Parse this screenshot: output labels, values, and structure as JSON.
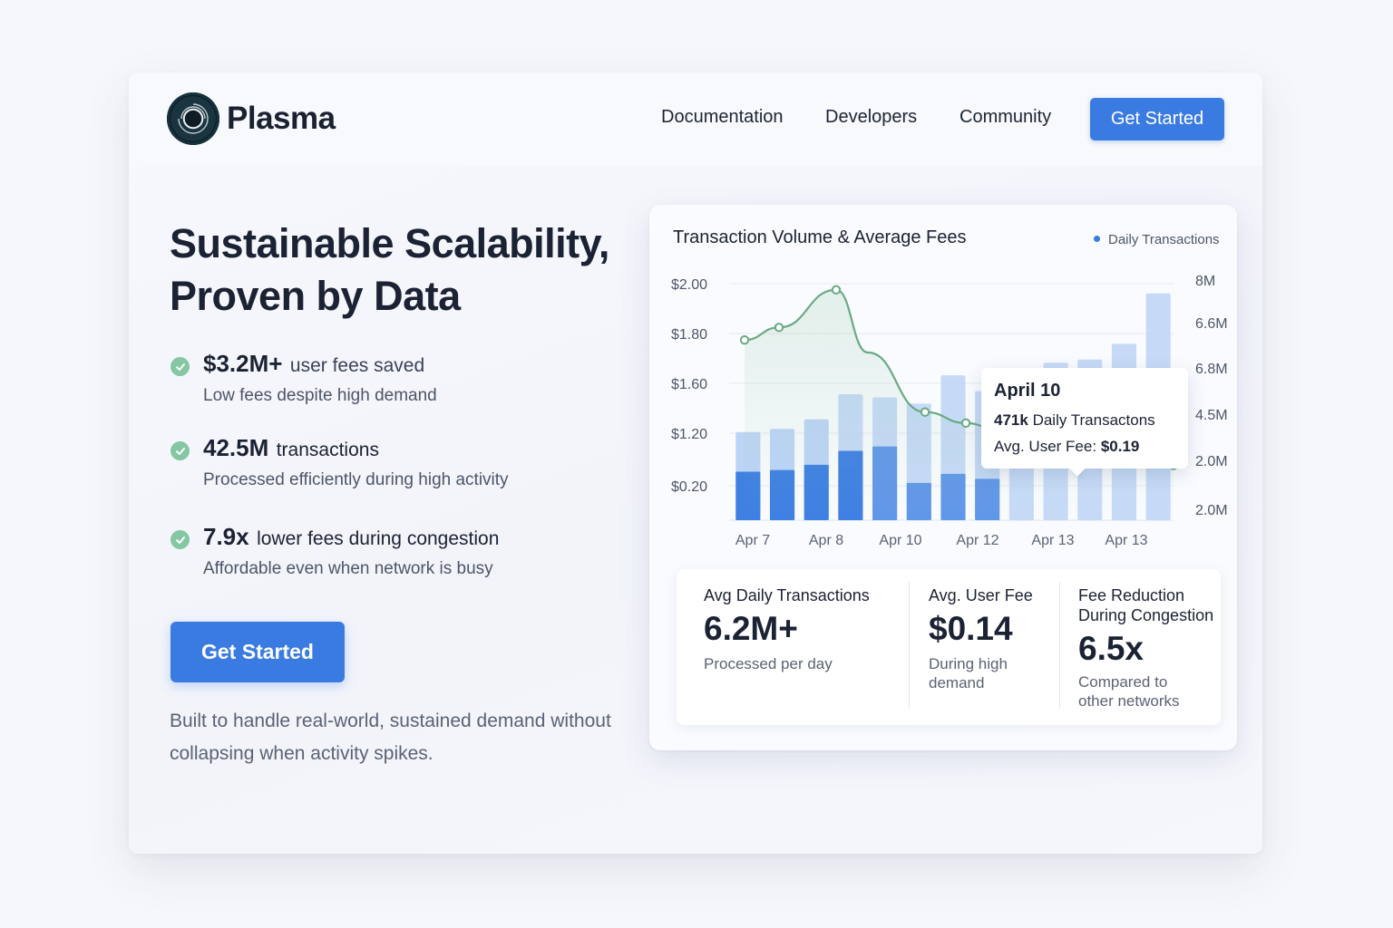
{
  "brand": {
    "name": "Plasma"
  },
  "nav": {
    "links": [
      "Documentation",
      "Developers",
      "Community"
    ],
    "cta": "Get Started"
  },
  "hero": {
    "title": "Sustainable Scalability, Proven by Data",
    "features": [
      {
        "highlight": "$3.2M+",
        "text": "user fees saved",
        "sub": "Low fees despite high demand"
      },
      {
        "highlight": "42.5M",
        "text": "transactions",
        "sub": "Processed efficiently during high activity"
      },
      {
        "highlight": "7.9x",
        "text": "lower fees during congestion",
        "sub": "Affordable even when network is busy"
      }
    ],
    "cta": "Get Started",
    "tagline": "Built to handle real-world, sustained demand without collapsing when activity spikes."
  },
  "chart_data": {
    "type": "bar",
    "title": "Transaction Volume & Average Fees",
    "legend": [
      "Daily Transactions"
    ],
    "legend_position": "top-right",
    "x_tick_labels": [
      "Apr 7",
      "Apr 8",
      "Apr 10",
      "Apr 12",
      "Apr 13",
      "Apr 13"
    ],
    "y_left_ticks": [
      "$2.00",
      "$1.80",
      "$1.60",
      "$1.20",
      "$0.20"
    ],
    "y_right_ticks": [
      "8M",
      "6.6M",
      "6.8M",
      "4.5M",
      "2.0M",
      "2.0M"
    ],
    "series": [
      {
        "name": "Daily Transactions",
        "kind": "bar",
        "values": [
          2.8,
          2.9,
          3.2,
          4.0,
          3.9,
          3.7,
          4.6,
          4.1,
          4.1,
          5.0,
          5.1,
          5.6,
          7.2
        ]
      },
      {
        "kind": "line",
        "values": [
          1.6,
          1.68,
          1.92,
          1.52,
          1.14,
          1.07,
          0.9,
          0.83,
          0.81,
          0.8
        ]
      }
    ],
    "tooltip": {
      "date": "April 10",
      "transactions": "471k",
      "transactions_label": "Daily Transactons",
      "fee_label": "Avg. User Fee:",
      "fee": "$0.19"
    }
  },
  "stats": [
    {
      "label": "Avg Daily Transactions",
      "value": "6.2M+",
      "note": "Processed per day"
    },
    {
      "label": "Avg. User Fee",
      "value": "$0.14",
      "note": "During high\ndemand"
    },
    {
      "label": "Fee Reduction\nDuring Congestion",
      "value": "6.5x",
      "note": "Compared to\nother networks"
    }
  ],
  "colors": {
    "accent": "#3a7be2",
    "check": "#84c7a2",
    "line": "#6aaa83",
    "bar_dark": "#3f80e3",
    "bar_light": "#b9d2f5"
  }
}
